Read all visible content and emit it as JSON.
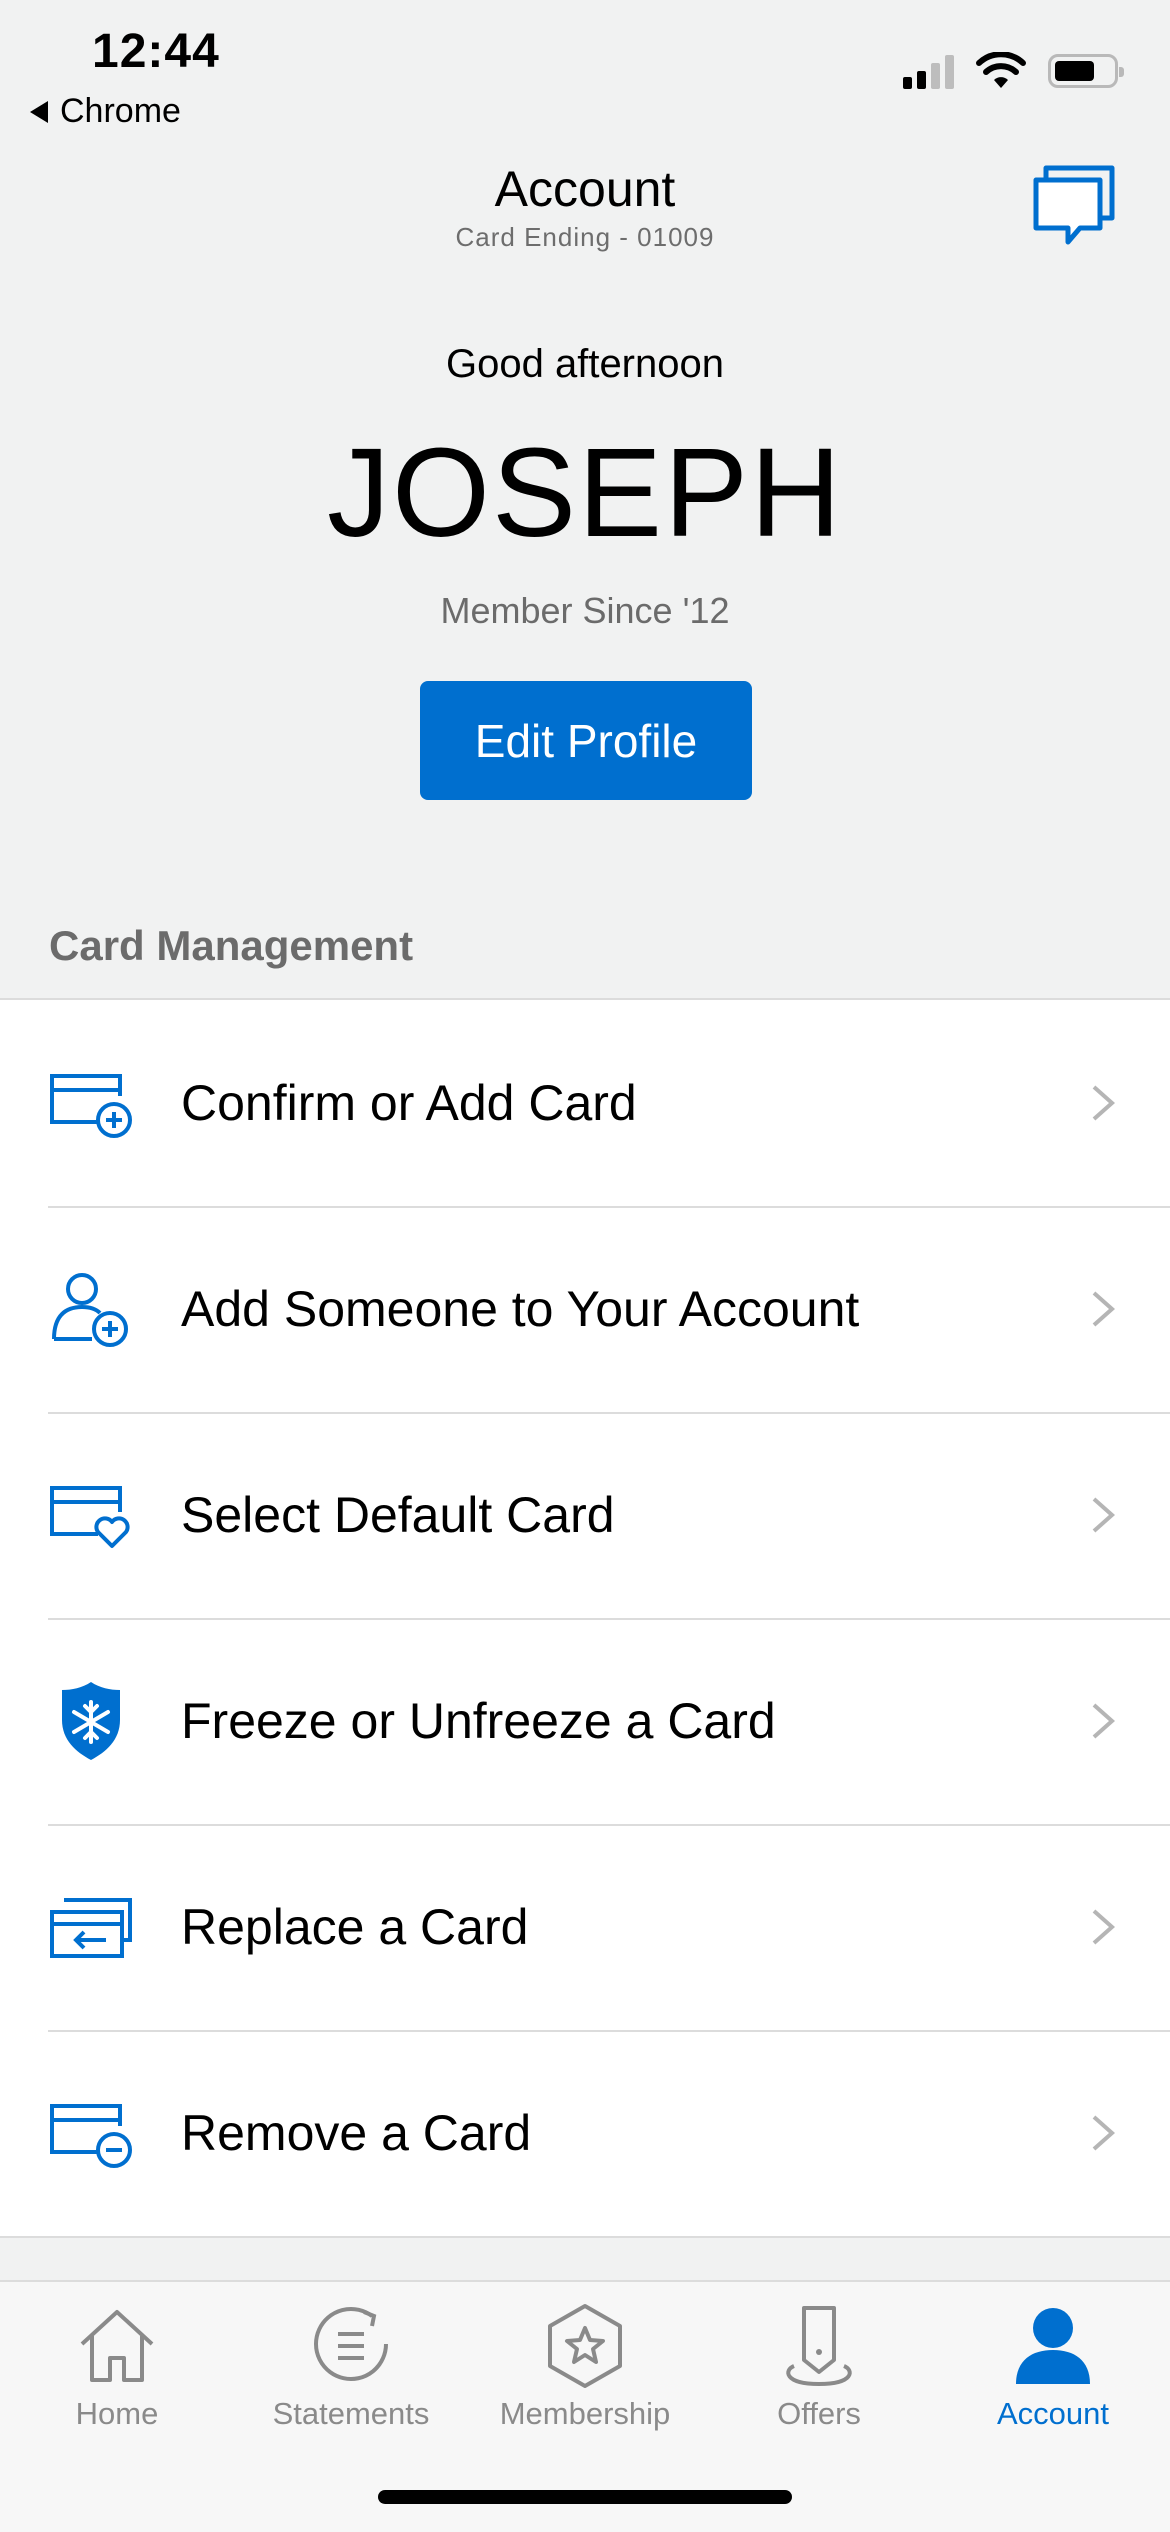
{
  "status_bar": {
    "time": "12:44",
    "back_app": "Chrome",
    "icons": [
      "signal-icon",
      "wifi-icon",
      "battery-icon"
    ]
  },
  "header": {
    "title": "Account",
    "subtitle": "Card Ending - 01009",
    "chat_icon": "chat-bubbles-icon"
  },
  "greeting": {
    "salutation": "Good afternoon",
    "name": "JOSEPH",
    "member_since": "Member Since '12",
    "edit_profile_label": "Edit Profile"
  },
  "card_management": {
    "title": "Card Management",
    "items": [
      {
        "label": "Confirm or Add Card",
        "icon": "card-add-icon"
      },
      {
        "label": "Add Someone to Your Account",
        "icon": "person-add-icon"
      },
      {
        "label": "Select Default Card",
        "icon": "card-heart-icon"
      },
      {
        "label": "Freeze or Unfreeze a Card",
        "icon": "snowflake-shield-icon"
      },
      {
        "label": "Replace a Card",
        "icon": "card-replace-icon"
      },
      {
        "label": "Remove a Card",
        "icon": "card-remove-icon"
      }
    ]
  },
  "tab_bar": {
    "tabs": [
      {
        "label": "Home",
        "icon": "home-icon",
        "active": false
      },
      {
        "label": "Statements",
        "icon": "statements-icon",
        "active": false
      },
      {
        "label": "Membership",
        "icon": "membership-star-icon",
        "active": false
      },
      {
        "label": "Offers",
        "icon": "offers-tag-icon",
        "active": false
      },
      {
        "label": "Account",
        "icon": "person-icon",
        "active": true
      }
    ]
  },
  "colors": {
    "accent": "#006fcf",
    "background": "#f1f2f2",
    "muted_text": "#6b6b6b",
    "inactive_tab": "#8a8a8a"
  }
}
